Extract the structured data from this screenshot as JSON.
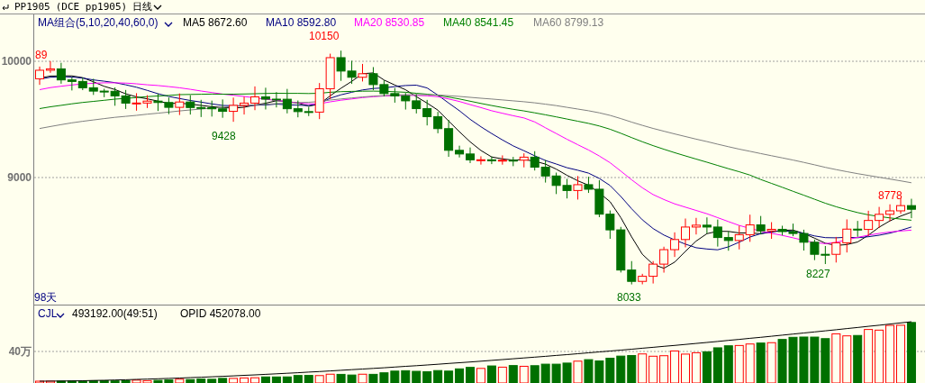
{
  "header": {
    "symbol": "PP1905",
    "exchange": "(DCE pp1905)",
    "period": "日线"
  },
  "main_panel": {
    "indicator": "MA组合(5,10,20,40,60,0)",
    "ma_legend": [
      {
        "label": "MA5 8672.60",
        "color": "#000000"
      },
      {
        "label": "MA10 8592.80",
        "color": "#000080"
      },
      {
        "label": "MA20 8530.85",
        "color": "#ff00ff"
      },
      {
        "label": "MA40 8541.45",
        "color": "#008000"
      },
      {
        "label": "MA60 8799.13",
        "color": "#808080"
      }
    ],
    "y_axis_labels": [
      "10000",
      "9000"
    ],
    "price_marks": [
      {
        "text": "89",
        "kind": "high"
      },
      {
        "text": "10150",
        "kind": "high"
      },
      {
        "text": "9428",
        "kind": "low"
      },
      {
        "text": "8033",
        "kind": "low"
      },
      {
        "text": "8227",
        "kind": "low"
      },
      {
        "text": "8778",
        "kind": "high"
      }
    ],
    "days": "98天"
  },
  "volume_panel": {
    "indicator": "CJL",
    "volume": "493192.00(49:51)",
    "open_interest": "OPID 452078.00",
    "y_axis_labels": [
      "40万"
    ]
  }
}
